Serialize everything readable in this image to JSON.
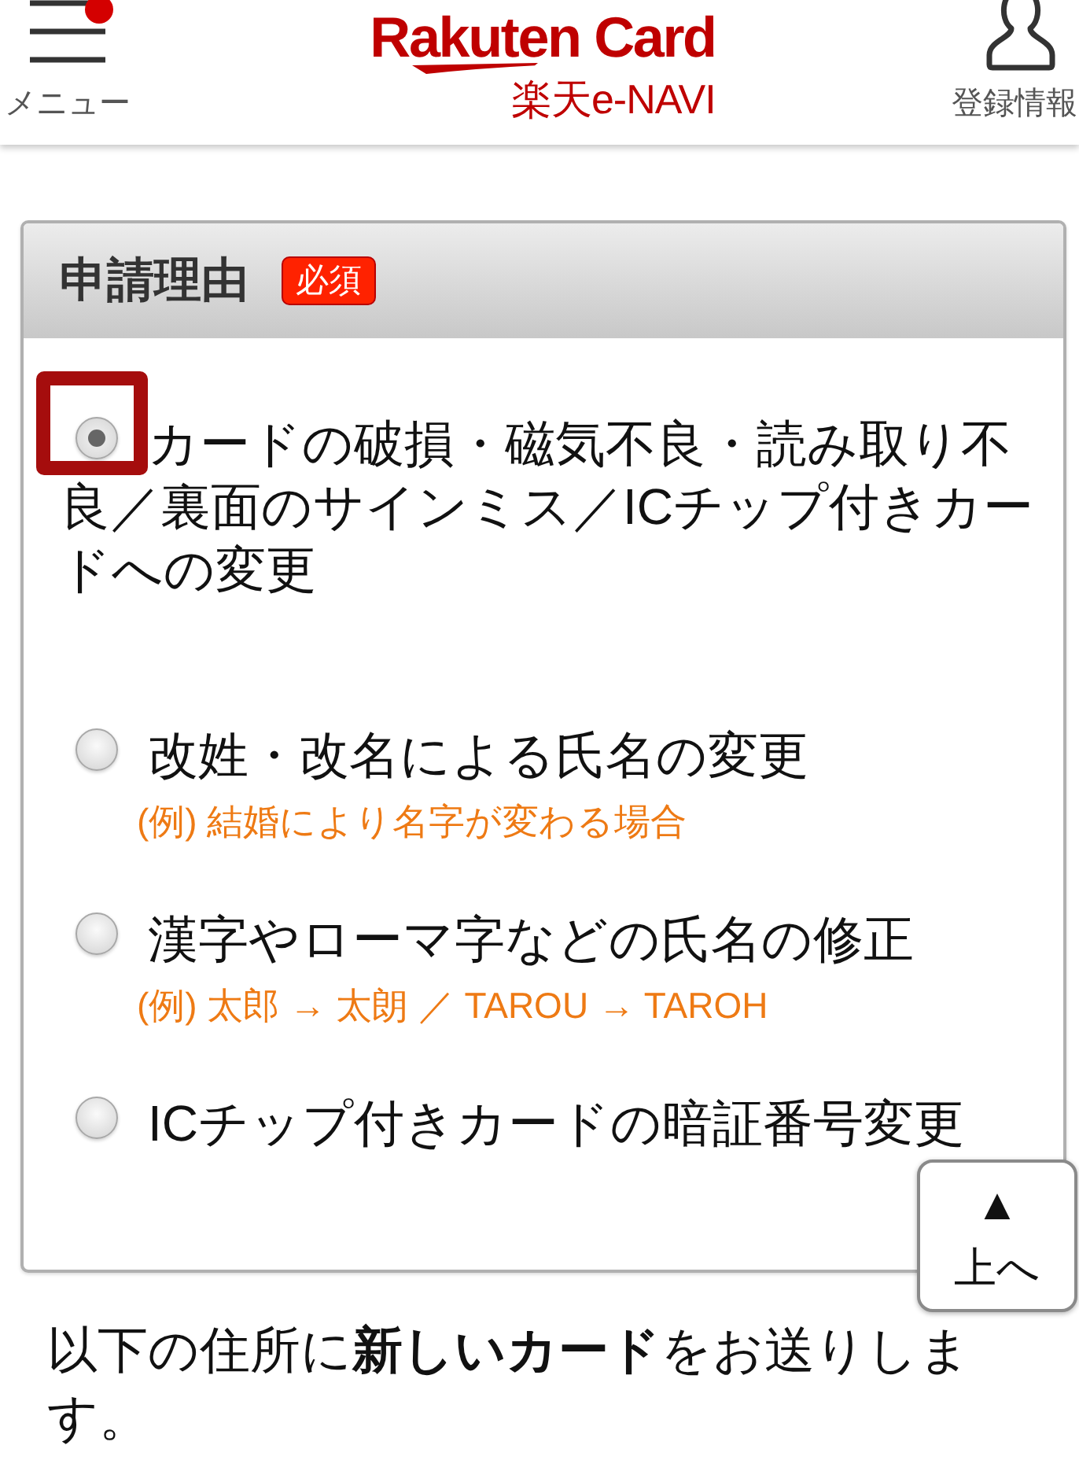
{
  "header": {
    "menu_label": "メニュー",
    "menu_notification": true,
    "logo": {
      "brand": "Rakuten Card",
      "service": "楽天e-NAVI"
    },
    "account_label": "登録情報"
  },
  "panel": {
    "title": "申請理由",
    "required_badge": "必須",
    "options": [
      {
        "label": "カードの破損・磁気不良・読み取り不良／裏面のサインミス／ICチップ付きカードへの変更",
        "selected": true,
        "highlighted": true
      },
      {
        "label": "改姓・改名による氏名の変更",
        "note": "(例) 結婚により名字が変わる場合",
        "selected": false,
        "highlighted": false
      },
      {
        "label": "漢字やローマ字などの氏名の修正",
        "note": "(例) 太郎 → 太朗 ／ TAROU → TAROH",
        "selected": false,
        "highlighted": false
      },
      {
        "label": "ICチップ付きカードの暗証番号変更",
        "selected": false,
        "highlighted": false
      }
    ]
  },
  "message": "以下の住所に**新しいカード**をお送りします。",
  "back_to_top": {
    "arrow": "▲",
    "label": "上へ"
  }
}
